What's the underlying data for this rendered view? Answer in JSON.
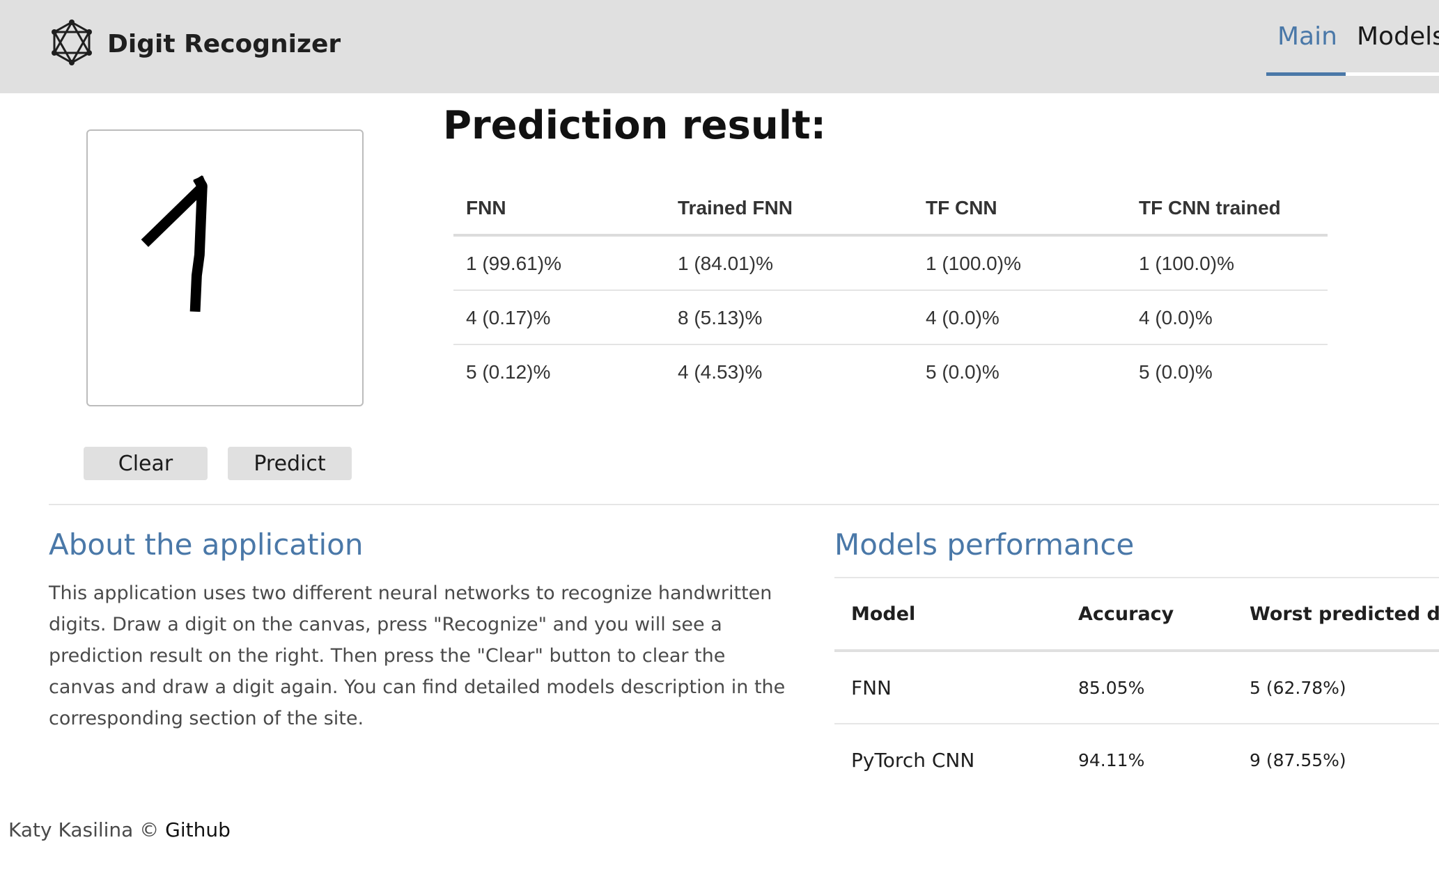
{
  "header": {
    "logo_icon": "neural-network-logo-icon",
    "title": "Digit Recognizer",
    "nav": [
      {
        "label": "Main",
        "active": true
      },
      {
        "label": "Models",
        "active": false
      }
    ],
    "accent_color": "#4a78a8"
  },
  "canvas": {
    "drawn_digit": "1"
  },
  "buttons": {
    "clear_label": "Clear",
    "predict_label": "Predict"
  },
  "prediction": {
    "title": "Prediction result:",
    "columns": [
      "FNN",
      "Trained FNN",
      "TF CNN",
      "TF CNN trained"
    ],
    "rows": [
      [
        "1 (99.61)%",
        "1 (84.01)%",
        "1 (100.0)%",
        "1 (100.0)%"
      ],
      [
        "4 (0.17)%",
        "8 (5.13)%",
        "4 (0.0)%",
        "4 (0.0)%"
      ],
      [
        "5 (0.12)%",
        "4 (4.53)%",
        "5 (0.0)%",
        "5 (0.0)%"
      ]
    ]
  },
  "about": {
    "title": "About the application",
    "text": "This application uses two different neural networks to recognize handwritten digits. Draw a digit on the canvas, press \"Recognize\" and you will see a prediction result on the right. Then press the \"Clear\" button to clear the canvas and draw a digit again. You can find detailed models description in the corresponding section of the site."
  },
  "performance": {
    "title": "Models performance",
    "columns": [
      "Model",
      "Accuracy",
      "Worst predicted digit"
    ],
    "rows": [
      [
        "FNN",
        "85.05%",
        "5 (62.78%)"
      ],
      [
        "PyTorch CNN",
        "94.11%",
        "9 (87.55%)"
      ]
    ]
  },
  "footer": {
    "author": "Katy Kasilina ©",
    "link_label": "Github"
  }
}
